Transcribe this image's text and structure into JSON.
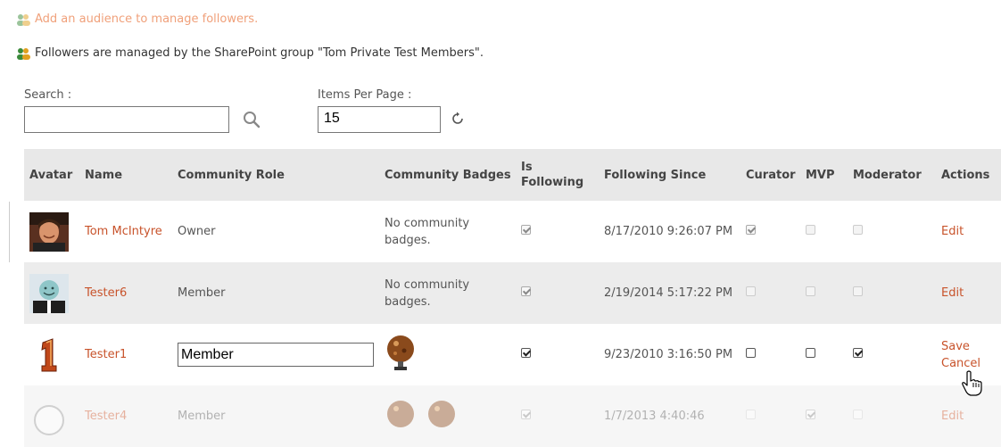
{
  "audience_link": "Add an audience to manage followers.",
  "managed_by_text": "Followers are managed by the SharePoint group \"Tom Private Test Members\".",
  "search": {
    "label": "Search :",
    "value": ""
  },
  "items_per_page": {
    "label": "Items Per Page :",
    "value": "15"
  },
  "columns": {
    "avatar": "Avatar",
    "name": "Name",
    "role": "Community Role",
    "badges": "Community Badges",
    "following": "Is Following",
    "since": "Following Since",
    "curator": "Curator",
    "mvp": "MVP",
    "moderator": "Moderator",
    "actions": "Actions"
  },
  "rows": [
    {
      "name": "Tom McIntyre",
      "role": "Owner",
      "badges": "No community badges.",
      "following": true,
      "since": "8/17/2010 9:26:07 PM",
      "curator": true,
      "mvp": false,
      "moderator": false,
      "action": "Edit"
    },
    {
      "name": "Tester6",
      "role": "Member",
      "badges": "No community badges.",
      "following": true,
      "since": "2/19/2014 5:17:22 PM",
      "curator": false,
      "mvp": false,
      "moderator": false,
      "action": "Edit"
    },
    {
      "name": "Tester1",
      "role": "Member",
      "badges": "",
      "following": true,
      "since": "9/23/2010 3:16:50 PM",
      "curator": false,
      "mvp": false,
      "moderator": true,
      "action_save": "Save",
      "action_cancel": "Cancel"
    },
    {
      "name": "Tester4",
      "role": "Member",
      "badges": "",
      "following": true,
      "since": "1/7/2013 4:40:46",
      "curator": false,
      "mvp": true,
      "moderator": false,
      "action": "Edit"
    }
  ],
  "colors": {
    "link": "#c8532b",
    "header_bg": "#e8e8e8",
    "alt_row_bg": "#ececec"
  }
}
